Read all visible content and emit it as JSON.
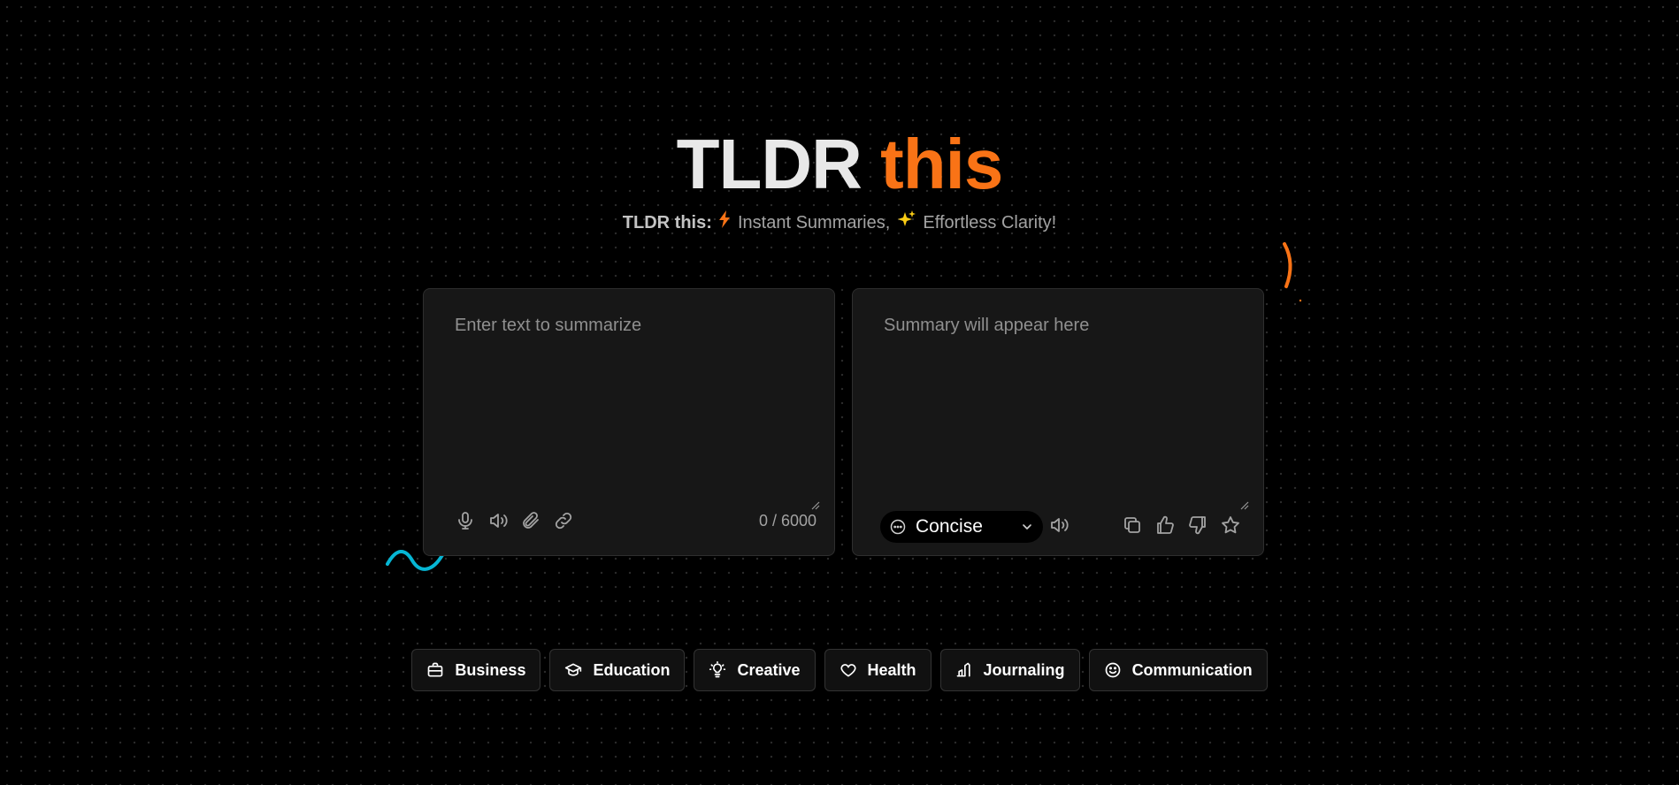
{
  "header": {
    "title_part1": "TLDR",
    "title_part2": "this",
    "subtitle_lead": "TLDR this:",
    "subtitle_part1": "Instant Summaries,",
    "subtitle_part2": "Effortless Clarity!"
  },
  "input_panel": {
    "placeholder": "Enter text to summarize",
    "char_count": "0 / 6000",
    "tools": [
      "microphone-icon",
      "speaker-icon",
      "paperclip-icon",
      "link-icon"
    ]
  },
  "output_panel": {
    "placeholder": "Summary will appear here",
    "mode": "Concise",
    "tools": [
      "speaker-icon",
      "copy-icon",
      "thumbs-up-icon",
      "thumbs-down-icon",
      "star-icon"
    ]
  },
  "categories": [
    {
      "label": "Business",
      "icon": "briefcase-icon"
    },
    {
      "label": "Education",
      "icon": "graduation-cap-icon"
    },
    {
      "label": "Creative",
      "icon": "lightbulb-icon"
    },
    {
      "label": "Health",
      "icon": "heart-icon"
    },
    {
      "label": "Journaling",
      "icon": "pen-icon"
    },
    {
      "label": "Communication",
      "icon": "smile-icon"
    }
  ],
  "colors": {
    "accent": "#f97316",
    "wave": "#06b6d4",
    "panel_bg": "#171717",
    "background": "#000000"
  }
}
